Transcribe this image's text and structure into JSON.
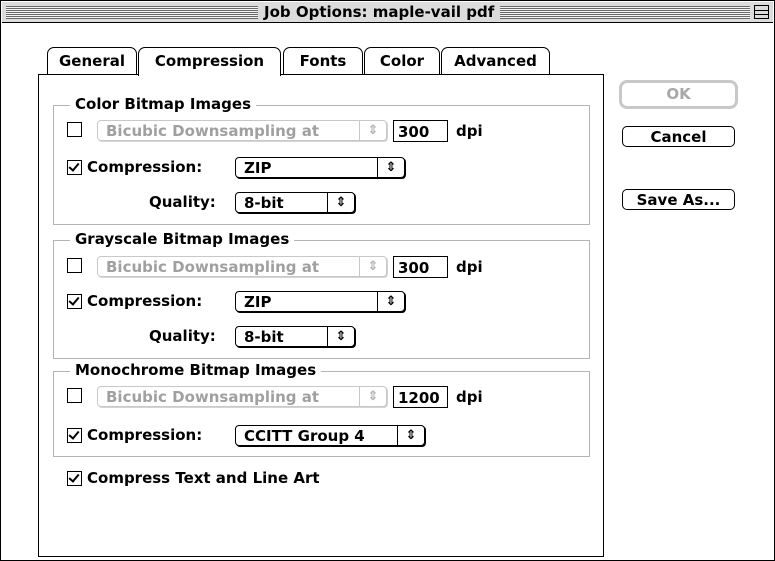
{
  "window": {
    "title": "Job Options: maple-vail pdf"
  },
  "tabs": [
    {
      "label": "General"
    },
    {
      "label": "Compression"
    },
    {
      "label": "Fonts"
    },
    {
      "label": "Color"
    },
    {
      "label": "Advanced"
    }
  ],
  "groups": {
    "color": {
      "title": "Color Bitmap Images",
      "downsampling_label": "Bicubic Downsampling at",
      "dpi_value": "300",
      "dpi_unit": "dpi",
      "compression_label": "Compression:",
      "compression_value": "ZIP",
      "quality_label": "Quality:",
      "quality_value": "8-bit"
    },
    "grayscale": {
      "title": "Grayscale Bitmap Images",
      "downsampling_label": "Bicubic Downsampling at",
      "dpi_value": "300",
      "dpi_unit": "dpi",
      "compression_label": "Compression:",
      "compression_value": "ZIP",
      "quality_label": "Quality:",
      "quality_value": "8-bit"
    },
    "mono": {
      "title": "Monochrome Bitmap Images",
      "downsampling_label": "Bicubic Downsampling at",
      "dpi_value": "1200",
      "dpi_unit": "dpi",
      "compression_label": "Compression:",
      "compression_value": "CCITT Group 4"
    }
  },
  "compress_text_label": "Compress Text and Line Art",
  "buttons": {
    "ok": "OK",
    "cancel": "Cancel",
    "save_as": "Save As..."
  },
  "icons": {
    "popup_arrow": "updown-arrow-icon",
    "zoom": "zoom-box-icon",
    "checkmark": "checkmark-icon"
  }
}
